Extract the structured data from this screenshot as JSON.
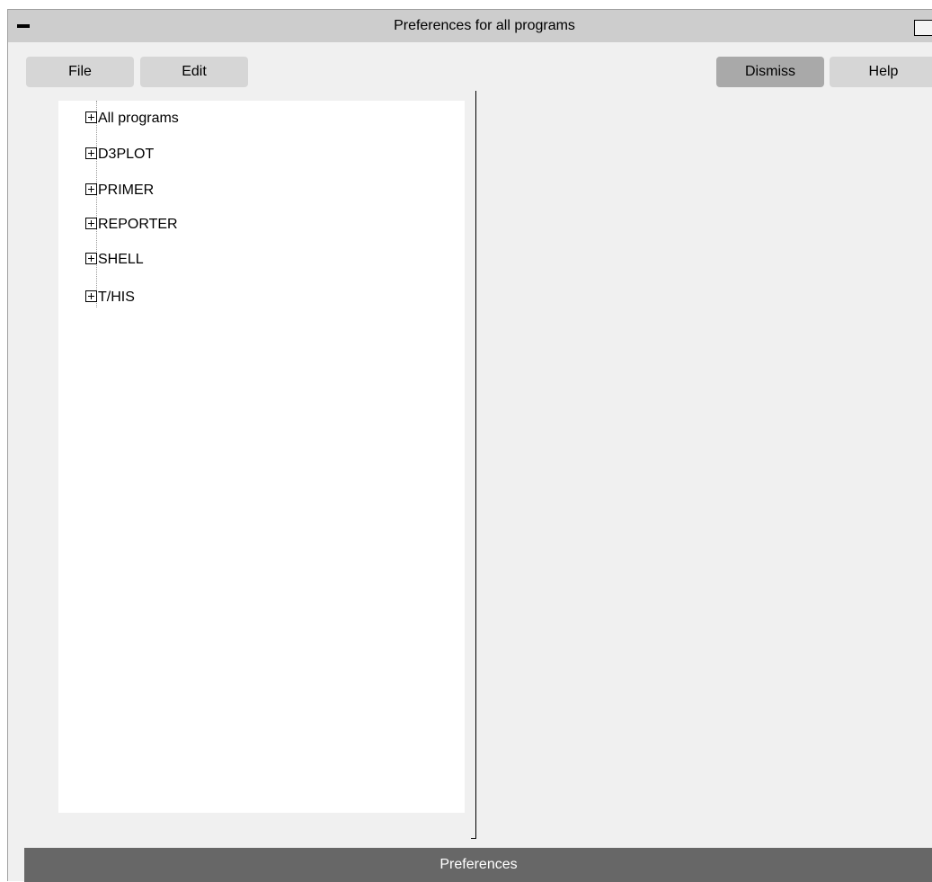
{
  "window": {
    "title": "Preferences for all programs"
  },
  "menu": {
    "file_label": "File",
    "edit_label": "Edit",
    "dismiss_label": "Dismiss",
    "help_label": "Help"
  },
  "tree": {
    "items": [
      {
        "label": "All programs",
        "expanded": false
      },
      {
        "label": "D3PLOT",
        "expanded": false
      },
      {
        "label": "PRIMER",
        "expanded": false
      },
      {
        "label": "REPORTER",
        "expanded": false
      },
      {
        "label": "SHELL",
        "expanded": false
      },
      {
        "label": "T/HIS",
        "expanded": false
      }
    ]
  },
  "status": {
    "text": "Preferences"
  },
  "icons": {
    "minimize": "minimize-icon",
    "maximize": "maximize-icon",
    "expand": "plus-box-icon"
  },
  "colors": {
    "window_bg": "#f0f0f0",
    "titlebar_bg": "#cdcdcd",
    "status_bar_bg": "#676767",
    "button_light": "#d6d6d6",
    "button_dark": "#a9a9a9"
  }
}
